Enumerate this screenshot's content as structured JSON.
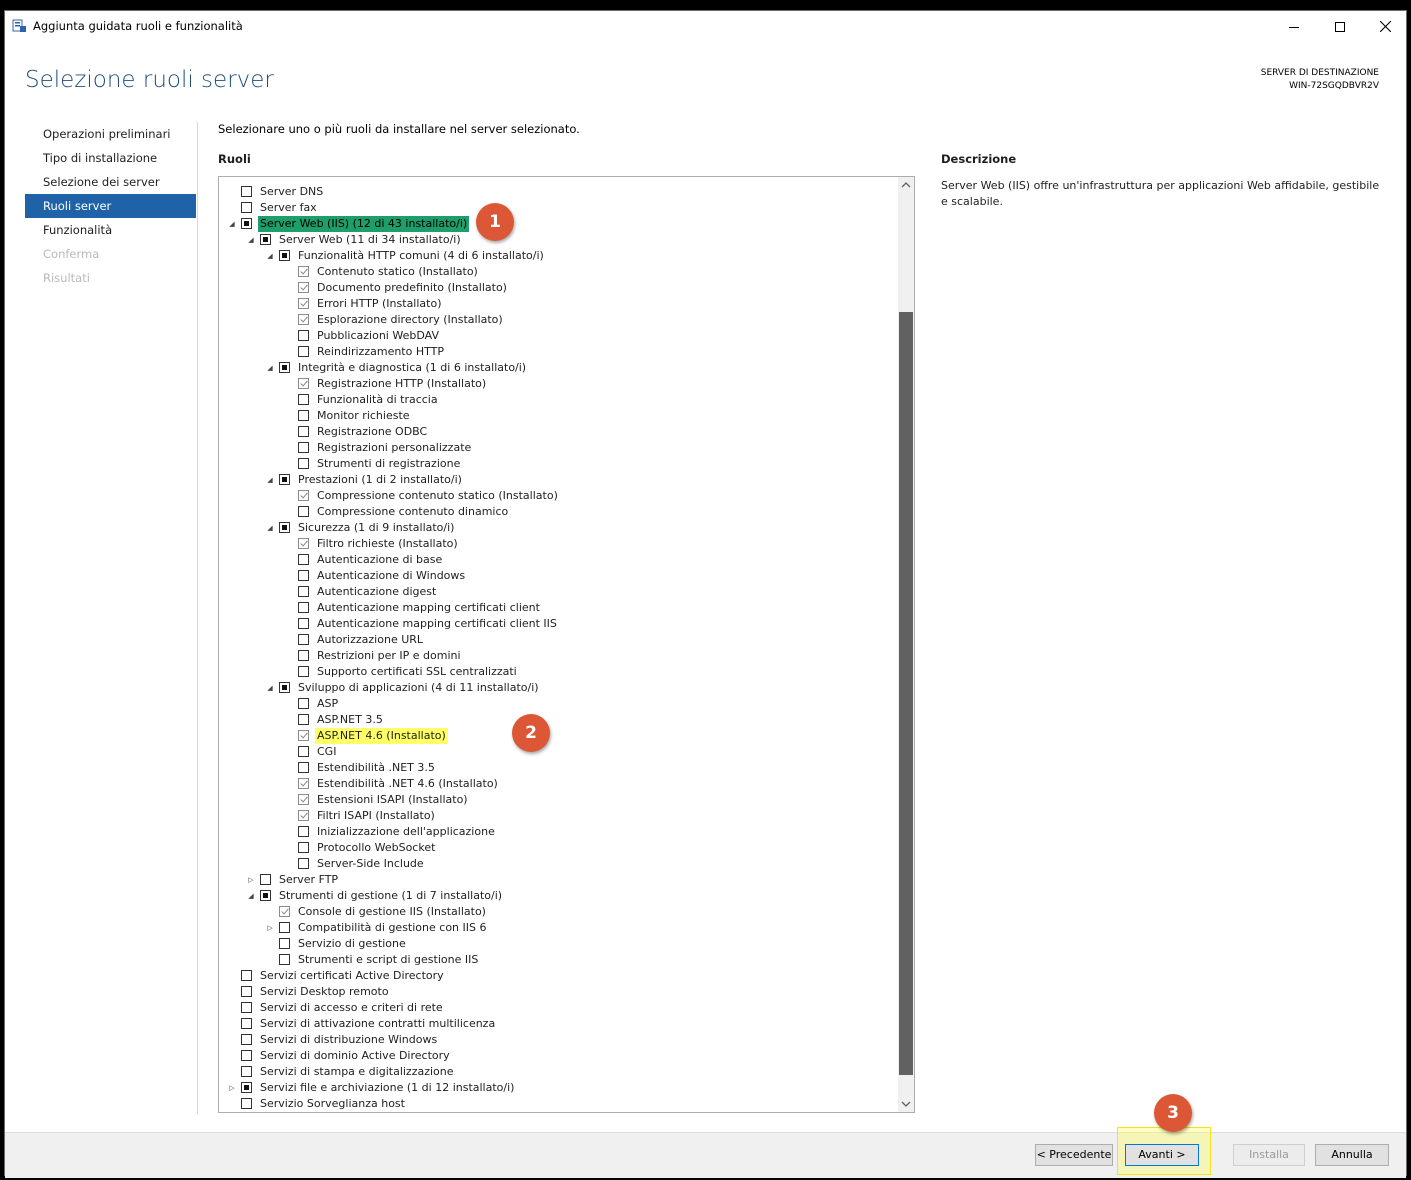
{
  "window": {
    "title": "Aggiunta guidata ruoli e funzionalità",
    "controls": {
      "minimize": "minimize-icon",
      "maximize": "maximize-icon",
      "close": "close-icon"
    }
  },
  "header": {
    "heading": "Selezione ruoli server",
    "destination_label": "SERVER DI DESTINAZIONE",
    "destination_server": "WIN-72SGQDBVR2V"
  },
  "nav": {
    "items": [
      {
        "label": "Operazioni preliminari",
        "state": "normal"
      },
      {
        "label": "Tipo di installazione",
        "state": "normal"
      },
      {
        "label": "Selezione dei server",
        "state": "normal"
      },
      {
        "label": "Ruoli server",
        "state": "active"
      },
      {
        "label": "Funzionalità",
        "state": "normal"
      },
      {
        "label": "Conferma",
        "state": "disabled"
      },
      {
        "label": "Risultati",
        "state": "disabled"
      }
    ]
  },
  "main": {
    "instruction": "Selezionare uno o più ruoli da installare nel server selezionato.",
    "roles_heading": "Ruoli",
    "description_heading": "Descrizione",
    "description_text": "Server Web (IIS) offre un'infrastruttura per applicazioni Web affidabile, gestibile e scalabile."
  },
  "tree": {
    "rows": [
      {
        "level": 1,
        "expander": "none",
        "check": "none",
        "label": "Server DNS"
      },
      {
        "level": 1,
        "expander": "none",
        "check": "none",
        "label": "Server fax"
      },
      {
        "level": 1,
        "expander": "expanded",
        "check": "partial",
        "label": "Server Web (IIS) (12 di 43 installato/i)",
        "highlight": "selected"
      },
      {
        "level": 2,
        "expander": "expanded",
        "check": "partial",
        "label": "Server Web (11 di 34 installato/i)"
      },
      {
        "level": 3,
        "expander": "expanded",
        "check": "partial",
        "label": "Funzionalità HTTP comuni (4 di 6 installato/i)"
      },
      {
        "level": 4,
        "expander": "none",
        "check": "checked",
        "label": "Contenuto statico (Installato)"
      },
      {
        "level": 4,
        "expander": "none",
        "check": "checked",
        "label": "Documento predefinito (Installato)"
      },
      {
        "level": 4,
        "expander": "none",
        "check": "checked",
        "label": "Errori HTTP (Installato)"
      },
      {
        "level": 4,
        "expander": "none",
        "check": "checked",
        "label": "Esplorazione directory (Installato)"
      },
      {
        "level": 4,
        "expander": "none",
        "check": "none",
        "label": "Pubblicazioni WebDAV"
      },
      {
        "level": 4,
        "expander": "none",
        "check": "none",
        "label": "Reindirizzamento HTTP"
      },
      {
        "level": 3,
        "expander": "expanded",
        "check": "partial",
        "label": "Integrità e diagnostica (1 di 6 installato/i)"
      },
      {
        "level": 4,
        "expander": "none",
        "check": "checked",
        "label": "Registrazione HTTP (Installato)"
      },
      {
        "level": 4,
        "expander": "none",
        "check": "none",
        "label": "Funzionalità di traccia"
      },
      {
        "level": 4,
        "expander": "none",
        "check": "none",
        "label": "Monitor richieste"
      },
      {
        "level": 4,
        "expander": "none",
        "check": "none",
        "label": "Registrazione ODBC"
      },
      {
        "level": 4,
        "expander": "none",
        "check": "none",
        "label": "Registrazioni personalizzate"
      },
      {
        "level": 4,
        "expander": "none",
        "check": "none",
        "label": "Strumenti di registrazione"
      },
      {
        "level": 3,
        "expander": "expanded",
        "check": "partial",
        "label": "Prestazioni (1 di 2 installato/i)"
      },
      {
        "level": 4,
        "expander": "none",
        "check": "checked",
        "label": "Compressione contenuto statico (Installato)"
      },
      {
        "level": 4,
        "expander": "none",
        "check": "none",
        "label": "Compressione contenuto dinamico"
      },
      {
        "level": 3,
        "expander": "expanded",
        "check": "partial",
        "label": "Sicurezza (1 di 9 installato/i)"
      },
      {
        "level": 4,
        "expander": "none",
        "check": "checked",
        "label": "Filtro richieste (Installato)"
      },
      {
        "level": 4,
        "expander": "none",
        "check": "none",
        "label": "Autenticazione di base"
      },
      {
        "level": 4,
        "expander": "none",
        "check": "none",
        "label": "Autenticazione di Windows"
      },
      {
        "level": 4,
        "expander": "none",
        "check": "none",
        "label": "Autenticazione digest"
      },
      {
        "level": 4,
        "expander": "none",
        "check": "none",
        "label": "Autenticazione mapping certificati client"
      },
      {
        "level": 4,
        "expander": "none",
        "check": "none",
        "label": "Autenticazione mapping certificati client IIS"
      },
      {
        "level": 4,
        "expander": "none",
        "check": "none",
        "label": "Autorizzazione URL"
      },
      {
        "level": 4,
        "expander": "none",
        "check": "none",
        "label": "Restrizioni per IP e domini"
      },
      {
        "level": 4,
        "expander": "none",
        "check": "none",
        "label": "Supporto certificati SSL centralizzati"
      },
      {
        "level": 3,
        "expander": "expanded",
        "check": "partial",
        "label": "Sviluppo di applicazioni (4 di 11 installato/i)"
      },
      {
        "level": 4,
        "expander": "none",
        "check": "none",
        "label": "ASP"
      },
      {
        "level": 4,
        "expander": "none",
        "check": "none",
        "label": "ASP.NET 3.5"
      },
      {
        "level": 4,
        "expander": "none",
        "check": "checked",
        "label": "ASP.NET 4.6 (Installato)",
        "highlight": "yellow"
      },
      {
        "level": 4,
        "expander": "none",
        "check": "none",
        "label": "CGI"
      },
      {
        "level": 4,
        "expander": "none",
        "check": "none",
        "label": "Estendibilità .NET 3.5"
      },
      {
        "level": 4,
        "expander": "none",
        "check": "checked",
        "label": "Estendibilità .NET 4.6 (Installato)"
      },
      {
        "level": 4,
        "expander": "none",
        "check": "checked",
        "label": "Estensioni ISAPI (Installato)"
      },
      {
        "level": 4,
        "expander": "none",
        "check": "checked",
        "label": "Filtri ISAPI (Installato)"
      },
      {
        "level": 4,
        "expander": "none",
        "check": "none",
        "label": "Inizializzazione dell'applicazione"
      },
      {
        "level": 4,
        "expander": "none",
        "check": "none",
        "label": "Protocollo WebSocket"
      },
      {
        "level": 4,
        "expander": "none",
        "check": "none",
        "label": "Server-Side Include"
      },
      {
        "level": 2,
        "expander": "collapsed",
        "check": "none",
        "label": "Server FTP"
      },
      {
        "level": 2,
        "expander": "expanded",
        "check": "partial",
        "label": "Strumenti di gestione (1 di 7 installato/i)"
      },
      {
        "level": 3,
        "expander": "none",
        "check": "checked",
        "label": "Console di gestione IIS (Installato)"
      },
      {
        "level": 3,
        "expander": "collapsed",
        "check": "none",
        "label": "Compatibilità di gestione con IIS 6"
      },
      {
        "level": 3,
        "expander": "none",
        "check": "none",
        "label": "Servizio di gestione"
      },
      {
        "level": 3,
        "expander": "none",
        "check": "none",
        "label": "Strumenti e script di gestione IIS"
      },
      {
        "level": 1,
        "expander": "none",
        "check": "none",
        "label": "Servizi certificati Active Directory"
      },
      {
        "level": 1,
        "expander": "none",
        "check": "none",
        "label": "Servizi Desktop remoto"
      },
      {
        "level": 1,
        "expander": "none",
        "check": "none",
        "label": "Servizi di accesso e criteri di rete"
      },
      {
        "level": 1,
        "expander": "none",
        "check": "none",
        "label": "Servizi di attivazione contratti multilicenza"
      },
      {
        "level": 1,
        "expander": "none",
        "check": "none",
        "label": "Servizi di distribuzione Windows"
      },
      {
        "level": 1,
        "expander": "none",
        "check": "none",
        "label": "Servizi di dominio Active Directory"
      },
      {
        "level": 1,
        "expander": "none",
        "check": "none",
        "label": "Servizi di stampa e digitalizzazione"
      },
      {
        "level": 1,
        "expander": "collapsed",
        "check": "partial",
        "label": "Servizi file e archiviazione (1 di 12 installato/i)"
      },
      {
        "level": 1,
        "expander": "none",
        "check": "none",
        "label": "Servizio Sorveglianza host"
      }
    ]
  },
  "footer": {
    "prev_label": "< Precedente",
    "next_label": "Avanti >",
    "install_label": "Installa",
    "cancel_label": "Annulla"
  },
  "annotations": {
    "badge1": "1",
    "badge2": "2",
    "badge3": "3"
  },
  "colors": {
    "accent": "#1f62a8",
    "heading": "#1e4e79",
    "badge": "#dc5736",
    "highlight": "#ffff66",
    "selection": "#1e9e6a"
  }
}
